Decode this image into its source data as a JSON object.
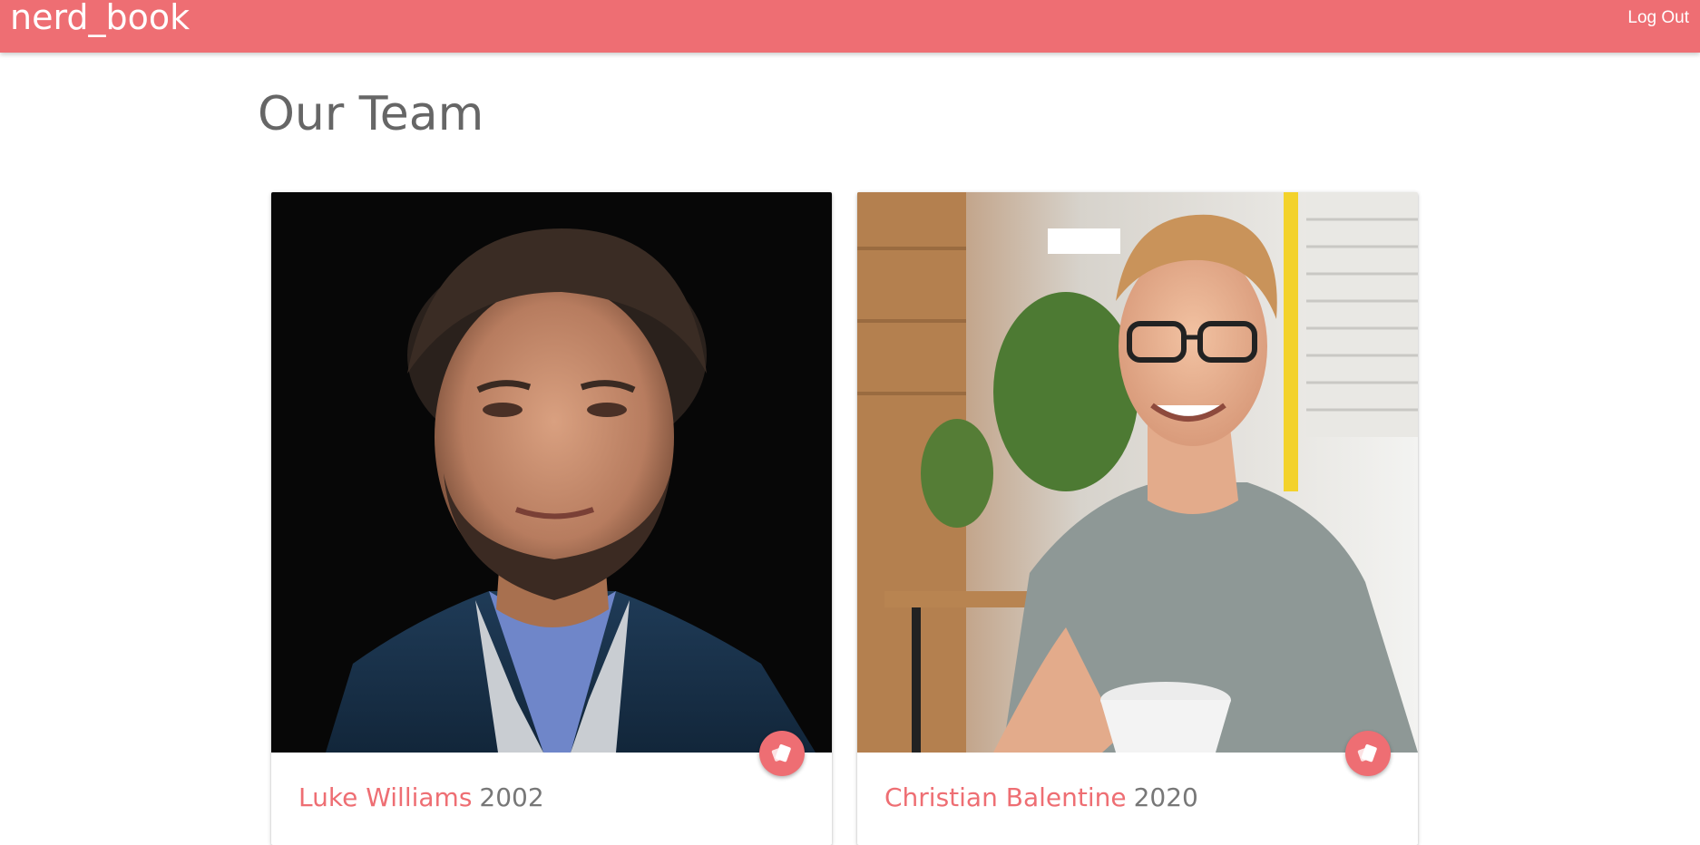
{
  "navbar": {
    "brand": "nerd_book",
    "logout_label": "Log Out",
    "color": "#ee6e73"
  },
  "page": {
    "title": "Our Team"
  },
  "team": [
    {
      "name": "Luke Williams",
      "year": "2002",
      "action_icon": "card-icon"
    },
    {
      "name": "Christian Balentine",
      "year": "2020",
      "action_icon": "card-icon"
    }
  ]
}
